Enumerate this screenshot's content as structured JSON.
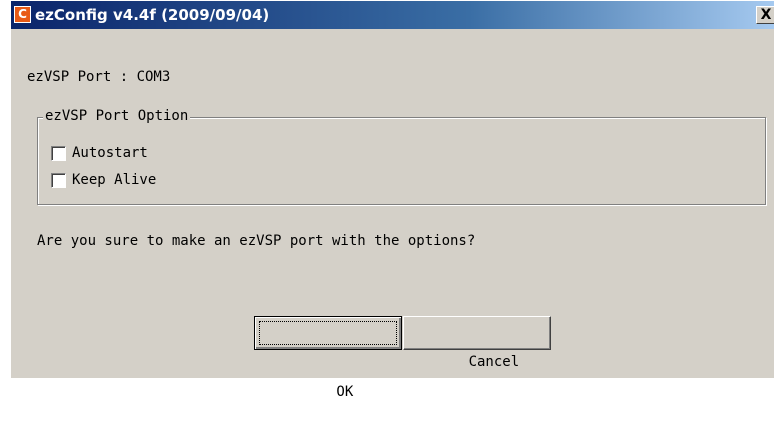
{
  "window": {
    "title": "ezConfig v4.4f (2009/09/04)",
    "app_icon_glyph": "C",
    "close_glyph": "X"
  },
  "port": {
    "line": "ezVSP Port : COM3"
  },
  "options": {
    "group_label": "ezVSP Port Option",
    "items": [
      {
        "label": "Autostart",
        "checked": false
      },
      {
        "label": "Keep Alive",
        "checked": false
      }
    ]
  },
  "question": "Are you sure to make an ezVSP port with the options?",
  "buttons": {
    "ok": "OK",
    "cancel": "Cancel"
  },
  "colors": {
    "titlebar_start": "#0a246a",
    "titlebar_end": "#a6caf0",
    "dialog_bg": "#d4d0c8",
    "app_icon": "#e85a16"
  }
}
